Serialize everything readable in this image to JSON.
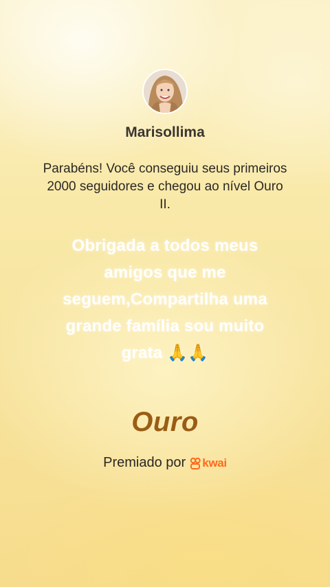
{
  "profile": {
    "username": "Marisollima"
  },
  "achievement": {
    "text": "Parabéns! Você conseguiu seus primeiros 2000 seguidores e chegou ao nível Ouro II.",
    "tier": "Ouro"
  },
  "message": {
    "text": "Obrigada a todos meus amigos que me seguem,Compartilha uma grande família sou muito grata 🙏🙏"
  },
  "footer": {
    "awarded_by": "Premiado por",
    "brand": "kwai",
    "brand_icon": "kwai-logo-icon"
  },
  "colors": {
    "tier": "#9a5c14",
    "brand": "#ff6a1a"
  }
}
